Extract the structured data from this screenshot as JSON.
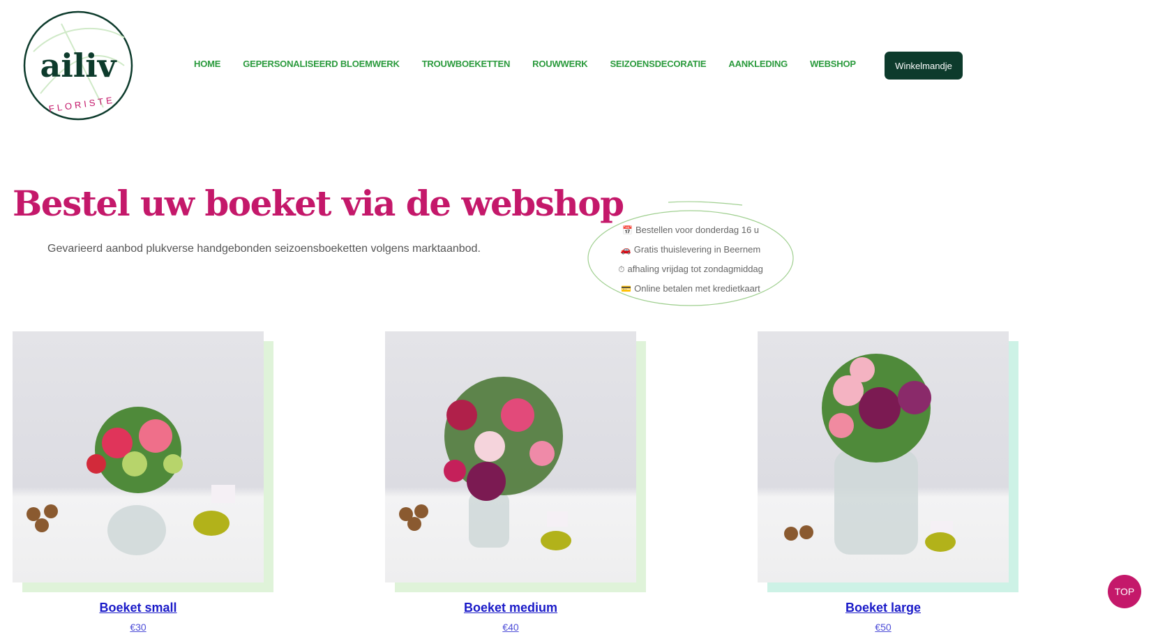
{
  "brand": {
    "logo_wordmark": "ailiv",
    "logo_subtitle": "FLORISTE",
    "colors": {
      "primary": "#c4186a",
      "dark_green": "#0d3b2c",
      "nav_green": "#2a9a3c",
      "leaf": "#cfe9c7"
    }
  },
  "nav": {
    "items": [
      {
        "label": "HOME"
      },
      {
        "label": "GEPERSONALISEERD BLOEMWERK"
      },
      {
        "label": "TROUWBOEKETTEN"
      },
      {
        "label": "ROUWWERK"
      },
      {
        "label": "SEIZOENSDECORATIE"
      },
      {
        "label": "AANKLEDING"
      },
      {
        "label": "WEBSHOP"
      }
    ],
    "cart_label": "Winkelmandje"
  },
  "hero": {
    "title": "Bestel uw boeket via de webshop",
    "subtitle": "Gevarieerd aanbod plukverse handgebonden seizoensboeketten volgens marktaanbod."
  },
  "info": {
    "items": [
      {
        "icon": "calendar-icon",
        "glyph": "📅",
        "text": "Bestellen voor donderdag 16 u"
      },
      {
        "icon": "car-icon",
        "glyph": "🚗",
        "text": "Gratis thuislevering in Beernem"
      },
      {
        "icon": "stopwatch-icon",
        "glyph": "⏱",
        "text": "afhaling vrijdag tot zondagmiddag"
      },
      {
        "icon": "credit-card-icon",
        "glyph": "💳",
        "text": "Online betalen met kredietkaart"
      }
    ]
  },
  "products": [
    {
      "name": "Boeket small",
      "price": "€30",
      "shadow_color": "#dff3d9"
    },
    {
      "name": "Boeket medium",
      "price": "€40",
      "shadow_color": "#dff3d9"
    },
    {
      "name": "Boeket large",
      "price": "€50",
      "shadow_color": "#cdf2e6"
    }
  ],
  "top_button": {
    "label": "TOP"
  }
}
